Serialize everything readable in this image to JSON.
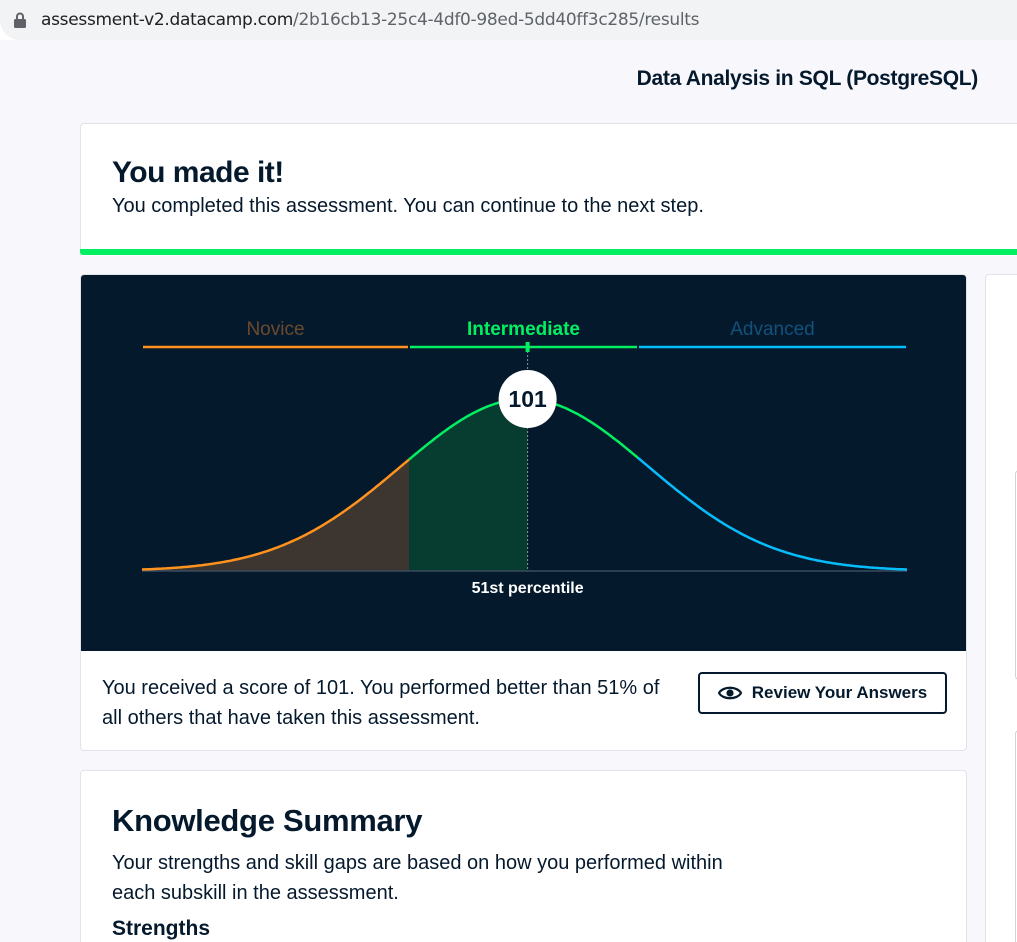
{
  "browser": {
    "url_host": "assessment-v2.datacamp.com",
    "url_path": "/2b16cb13-25c4-4df0-98ed-5dd40ff3c285/results"
  },
  "page": {
    "title": "Data Analysis in SQL (PostgreSQL)"
  },
  "banner": {
    "heading": "You made it!",
    "message": "You completed this assessment. You can continue to the next step.",
    "accent_color": "#03ef62"
  },
  "chart_data": {
    "type": "area",
    "levels": [
      {
        "name": "Novice",
        "color": "#ff931e",
        "active": false
      },
      {
        "name": "Intermediate",
        "color": "#03ef62",
        "active": true
      },
      {
        "name": "Advanced",
        "color": "#06bdfc",
        "active": false
      }
    ],
    "score": "101",
    "percentile_label": "51st percentile",
    "percentile": 51,
    "background": "#05192d"
  },
  "score_summary": {
    "text": "You received a score of 101. You performed better than 51% of all others that have taken this assessment.",
    "review_button": "Review Your Answers"
  },
  "knowledge": {
    "heading": "Knowledge Summary",
    "description": "Your strengths and skill gaps are based on how you performed within each subskill in the assessment.",
    "strengths_heading": "Strengths"
  }
}
